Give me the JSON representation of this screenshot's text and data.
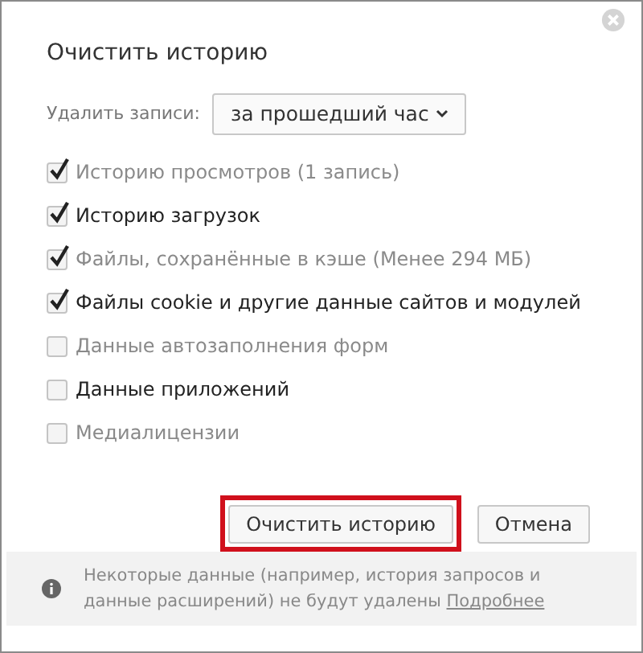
{
  "dialog": {
    "title": "Очистить историю"
  },
  "range": {
    "label": "Удалить записи:",
    "value": "за прошедший час"
  },
  "options": [
    {
      "label": "Историю просмотров",
      "note": "(1 запись)",
      "checked": true,
      "muted": true
    },
    {
      "label": "Историю загрузок",
      "checked": true,
      "muted": false
    },
    {
      "label": "Файлы, сохранённые в кэше",
      "note": "(Менее 294 МБ)",
      "checked": true,
      "muted": true
    },
    {
      "label": "Файлы cookie и другие данные сайтов и модулей",
      "checked": true,
      "muted": false
    },
    {
      "label": "Данные автозаполнения форм",
      "checked": false,
      "muted": true
    },
    {
      "label": "Данные приложений",
      "checked": false,
      "muted": false
    },
    {
      "label": "Медиалицензии",
      "checked": false,
      "muted": true
    }
  ],
  "buttons": [
    {
      "label": "Очистить историю",
      "highlighted": true
    },
    {
      "label": "Отмена",
      "highlighted": false
    }
  ],
  "footer": {
    "text": "Некоторые данные (например, история запросов и данные расширений) не будут удалены",
    "link": "Подробнее"
  }
}
